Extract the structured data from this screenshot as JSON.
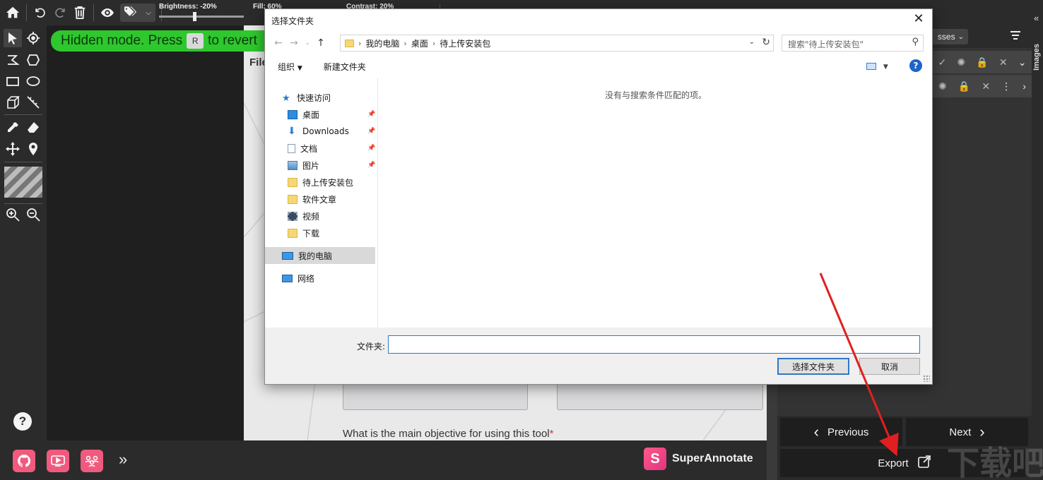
{
  "toolbar": {
    "brightness_label": "Brightness: -20%",
    "brightness_value": 0.4,
    "fill_label": "Fill: 60%",
    "fill_value": 0.6,
    "contrast_label": "Contrast: 20%"
  },
  "banner": {
    "text_before": "Hidden mode. Press",
    "key": "R",
    "text_after": "to revert"
  },
  "document": {
    "file_label": "File",
    "question": "What is the main objective for using this tool",
    "required_mark": "*"
  },
  "right_panel": {
    "classes_label": "sses",
    "side_label": "Images",
    "previous_label": "Previous",
    "next_label": "Next",
    "export_label": "Export"
  },
  "bottom_bar": {
    "brand_letter": "S",
    "brand_name": "SuperAnnotate"
  },
  "dialog": {
    "title": "选择文件夹",
    "breadcrumbs": [
      "我的电脑",
      "桌面",
      "待上传安装包"
    ],
    "search_placeholder": "搜索\"待上传安装包\"",
    "organize_label": "组织",
    "new_folder_label": "新建文件夹",
    "sidebar": {
      "quick_access": "快速访问",
      "items": [
        {
          "label": "桌面",
          "icon": "desktop-icon",
          "pinned": true
        },
        {
          "label": "Downloads",
          "icon": "download-arrow-icon",
          "pinned": true
        },
        {
          "label": "文档",
          "icon": "document-icon",
          "pinned": true
        },
        {
          "label": "图片",
          "icon": "picture-icon",
          "pinned": true
        },
        {
          "label": "待上传安装包",
          "icon": "folder-icon",
          "pinned": false
        },
        {
          "label": "软件文章",
          "icon": "folder-icon",
          "pinned": false
        },
        {
          "label": "视频",
          "icon": "video-icon",
          "pinned": false
        },
        {
          "label": "下载",
          "icon": "folder-icon",
          "pinned": false
        }
      ],
      "this_pc": "我的电脑",
      "network": "网络"
    },
    "empty_message": "没有与搜索条件匹配的项。",
    "folder_field_label": "文件夹:",
    "folder_field_value": "",
    "select_button": "选择文件夹",
    "cancel_button": "取消"
  },
  "colors": {
    "banner_green": "#2ec72e",
    "accent_blue": "#2f78c5",
    "brand_pink": "#f05a7e",
    "arrow_red": "#e02020"
  },
  "watermark": "下载吧"
}
